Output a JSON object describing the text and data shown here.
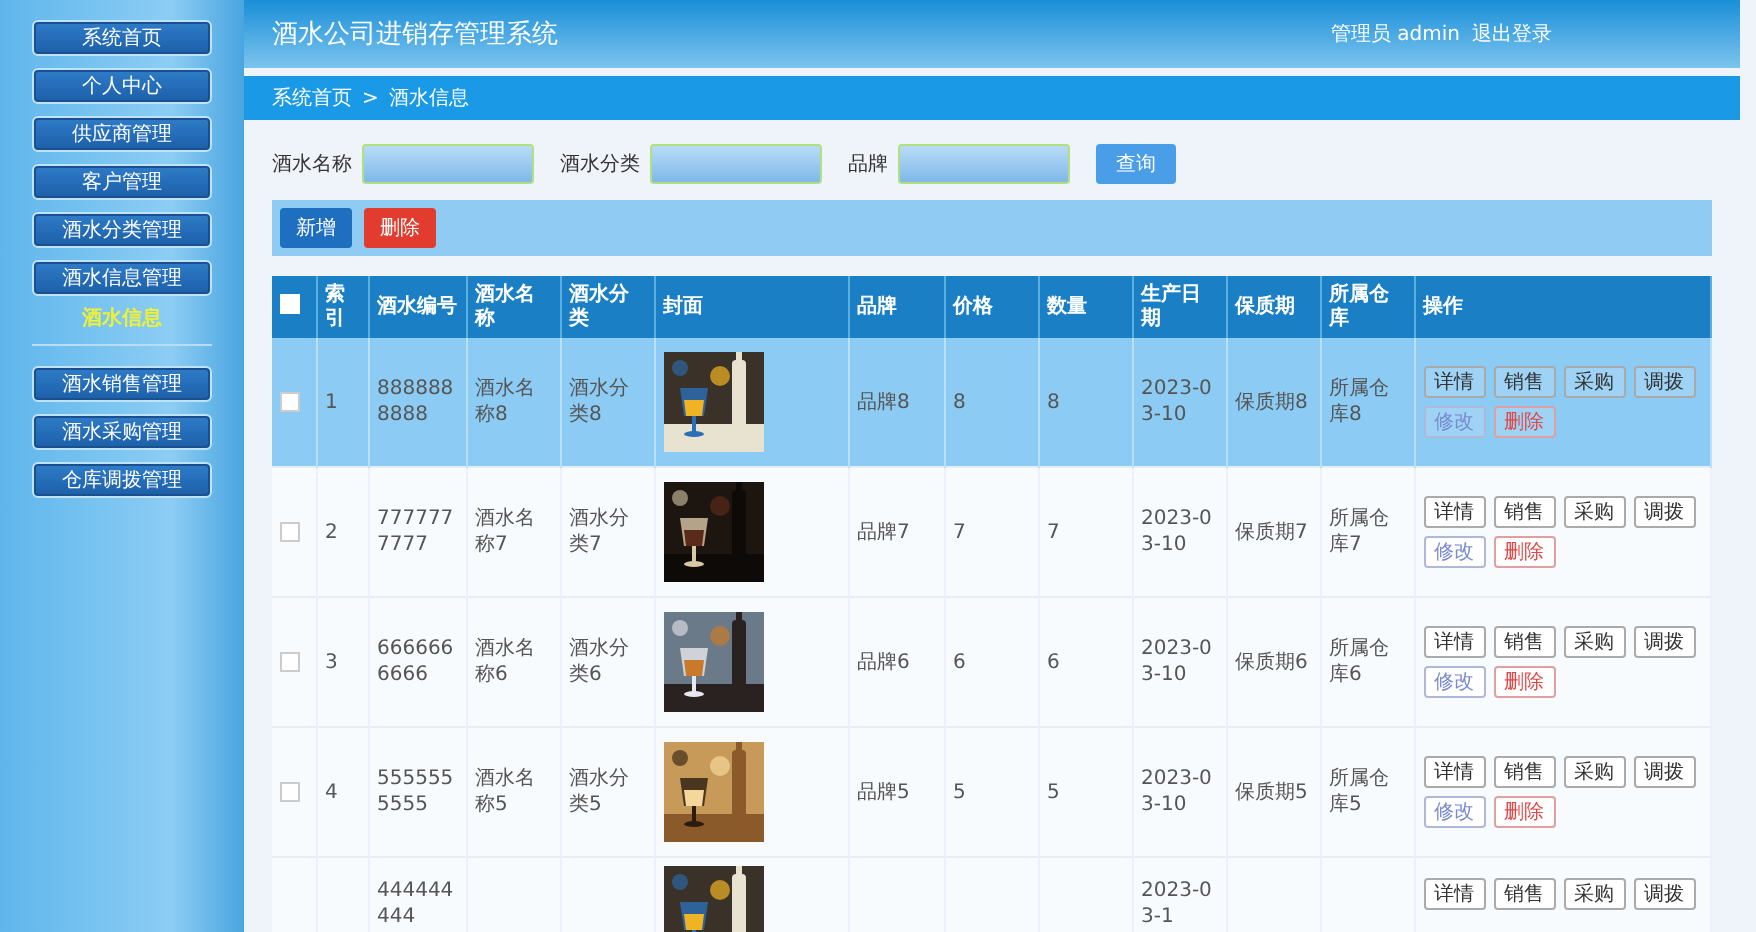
{
  "sidebar": {
    "items": [
      {
        "label": "系统首页",
        "selected": false
      },
      {
        "label": "个人中心",
        "selected": false
      },
      {
        "label": "供应商管理",
        "selected": false
      },
      {
        "label": "客户管理",
        "selected": false
      },
      {
        "label": "酒水分类管理",
        "selected": false
      },
      {
        "label": "酒水信息管理",
        "selected": false,
        "children": [
          {
            "label": "酒水信息",
            "selected": true
          }
        ]
      },
      {
        "label": "酒水销售管理",
        "selected": false
      },
      {
        "label": "酒水采购管理",
        "selected": false
      },
      {
        "label": "仓库调拨管理",
        "selected": false
      }
    ]
  },
  "header": {
    "title": "酒水公司进销存管理系统",
    "user": "管理员 admin",
    "logout": "退出登录"
  },
  "breadcrumb": [
    "系统首页",
    "酒水信息"
  ],
  "breadcrumb_separator": ">",
  "search": {
    "fields": [
      {
        "label": "酒水名称"
      },
      {
        "label": "酒水分类"
      },
      {
        "label": "品牌"
      }
    ],
    "button": "查询"
  },
  "toolbar": [
    {
      "label": "新增",
      "kind": "primary"
    },
    {
      "label": "删除",
      "kind": "danger"
    }
  ],
  "table": {
    "header_checked": false,
    "columns": [
      "索引",
      "酒水编号",
      "酒水名称",
      "酒水分类",
      "封面",
      "品牌",
      "价格",
      "数量",
      "生产日期",
      "保质期",
      "所属仓库",
      "操作"
    ],
    "rows": [
      {
        "selected": true,
        "checked": false,
        "index": "1",
        "number": "8888888888",
        "name": "酒水名称8",
        "category": "酒水分类8",
        "brand": "品牌8",
        "price": "8",
        "quantity": "8",
        "date": "2023-03-10",
        "shelf_life": "保质期8",
        "warehouse": "所属仓库8",
        "actions": [
          {
            "label": "详情",
            "kind": "default"
          },
          {
            "label": "销售",
            "kind": "default"
          },
          {
            "label": "采购",
            "kind": "default"
          },
          {
            "label": "调拨",
            "kind": "default"
          },
          {
            "label": "修改",
            "kind": "edit"
          },
          {
            "label": "删除",
            "kind": "danger"
          }
        ]
      },
      {
        "selected": false,
        "checked": false,
        "index": "2",
        "number": "7777777777",
        "name": "酒水名称7",
        "category": "酒水分类7",
        "brand": "品牌7",
        "price": "7",
        "quantity": "7",
        "date": "2023-03-10",
        "shelf_life": "保质期7",
        "warehouse": "所属仓库7",
        "actions": [
          {
            "label": "详情",
            "kind": "default"
          },
          {
            "label": "销售",
            "kind": "default"
          },
          {
            "label": "采购",
            "kind": "default"
          },
          {
            "label": "调拨",
            "kind": "default"
          },
          {
            "label": "修改",
            "kind": "edit"
          },
          {
            "label": "删除",
            "kind": "danger"
          }
        ]
      },
      {
        "selected": false,
        "checked": false,
        "index": "3",
        "number": "6666666666",
        "name": "酒水名称6",
        "category": "酒水分类6",
        "brand": "品牌6",
        "price": "6",
        "quantity": "6",
        "date": "2023-03-10",
        "shelf_life": "保质期6",
        "warehouse": "所属仓库6",
        "actions": [
          {
            "label": "详情",
            "kind": "default"
          },
          {
            "label": "销售",
            "kind": "default"
          },
          {
            "label": "采购",
            "kind": "default"
          },
          {
            "label": "调拨",
            "kind": "default"
          },
          {
            "label": "修改",
            "kind": "edit"
          },
          {
            "label": "删除",
            "kind": "danger"
          }
        ]
      },
      {
        "selected": false,
        "checked": false,
        "index": "4",
        "number": "5555555555",
        "name": "酒水名称5",
        "category": "酒水分类5",
        "brand": "品牌5",
        "price": "5",
        "quantity": "5",
        "date": "2023-03-10",
        "shelf_life": "保质期5",
        "warehouse": "所属仓库5",
        "actions": [
          {
            "label": "详情",
            "kind": "default"
          },
          {
            "label": "销售",
            "kind": "default"
          },
          {
            "label": "采购",
            "kind": "default"
          },
          {
            "label": "调拨",
            "kind": "default"
          },
          {
            "label": "修改",
            "kind": "edit"
          },
          {
            "label": "删除",
            "kind": "danger"
          }
        ]
      },
      {
        "selected": false,
        "number": "444444444",
        "date": "2023-03-1",
        "actions": [
          {
            "label": "详情",
            "kind": "default"
          },
          {
            "label": "销售",
            "kind": "default"
          },
          {
            "label": "采购",
            "kind": "default"
          },
          {
            "label": "调拨",
            "kind": "default"
          }
        ]
      }
    ]
  }
}
